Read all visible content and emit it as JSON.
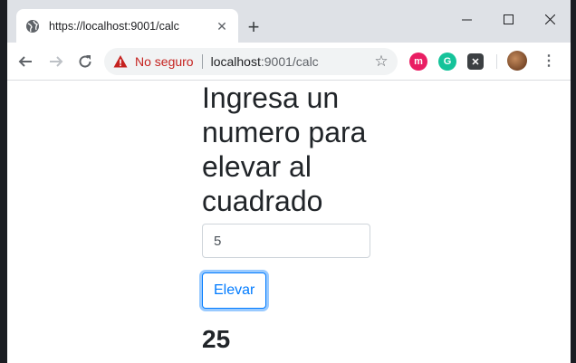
{
  "browser": {
    "tab_title": "https://localhost:9001/calc",
    "tab_close": "✕",
    "new_tab": "+",
    "insecure_label": "No seguro",
    "url_host": "localhost",
    "url_path": ":9001/calc",
    "menu": "⋮"
  },
  "page": {
    "heading": "Ingresa un numero para elevar al cuadrado",
    "input_value": "5",
    "button_label": "Elevar",
    "result": "25"
  },
  "colors": {
    "primary": "#007bff",
    "insecure": "#c5221f",
    "titlebar": "#dee1e6"
  }
}
